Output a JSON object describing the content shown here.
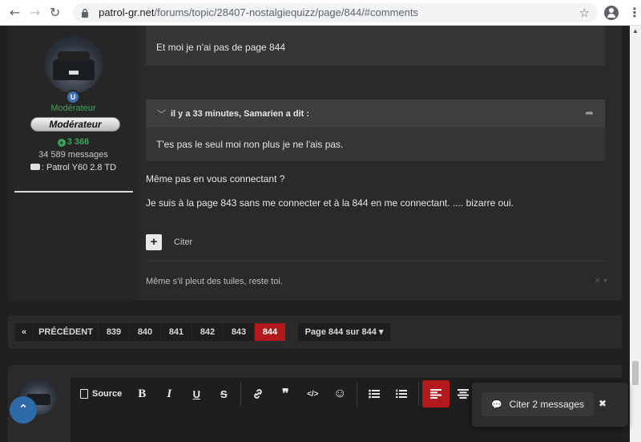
{
  "browser": {
    "url_host": "patrol-gr.net",
    "url_path": "/forums/topic/28407-nostalgiequizz/page/844/#comments",
    "back_icon": "←",
    "forward_icon": "→",
    "reload_icon": "↻",
    "star_icon": "☆",
    "menu_icon": "⋮"
  },
  "author": {
    "title": "Modérateur",
    "rank": "Modérateur",
    "badge_letter": "U",
    "reputation": "3 366",
    "posts": "34 589 messages",
    "vehicle": ": Patrol Y60 2.8 TD"
  },
  "post": {
    "quote1_text": "Et moi je n'ai pas de page 844",
    "quote2_header": "il y a 33 minutes, Samarien a dit :",
    "quote2_text": "T'es pas le seul moi non plus je ne l'ais pas.",
    "paragraph1": "Même pas en vous connectant ?",
    "paragraph2": "Je suis à la page 843 sans me connecter et à la 844 en me connectant. .... bizarre oui.",
    "add_label": "+",
    "cite_label": "Citer",
    "signature": "Même s'il pleut des tuiles, reste toi.",
    "signature_control": "✕ ▾"
  },
  "pagination": {
    "first": "«",
    "prev": "PRÉCÉDENT",
    "pages": [
      "839",
      "840",
      "841",
      "842",
      "843",
      "844"
    ],
    "current": "844",
    "jump": "Page 844 sur 844 ▾"
  },
  "editor": {
    "source_label": "Source",
    "bold": "B",
    "italic": "I",
    "underline": "U",
    "strike": "S",
    "link": "🔗",
    "quote": "❞",
    "code": "</>",
    "emoji": "☺"
  },
  "multiquote": {
    "label": "Citer 2 messages",
    "icon": "💬",
    "close": "✖"
  },
  "scroll_top_icon": "⌃"
}
